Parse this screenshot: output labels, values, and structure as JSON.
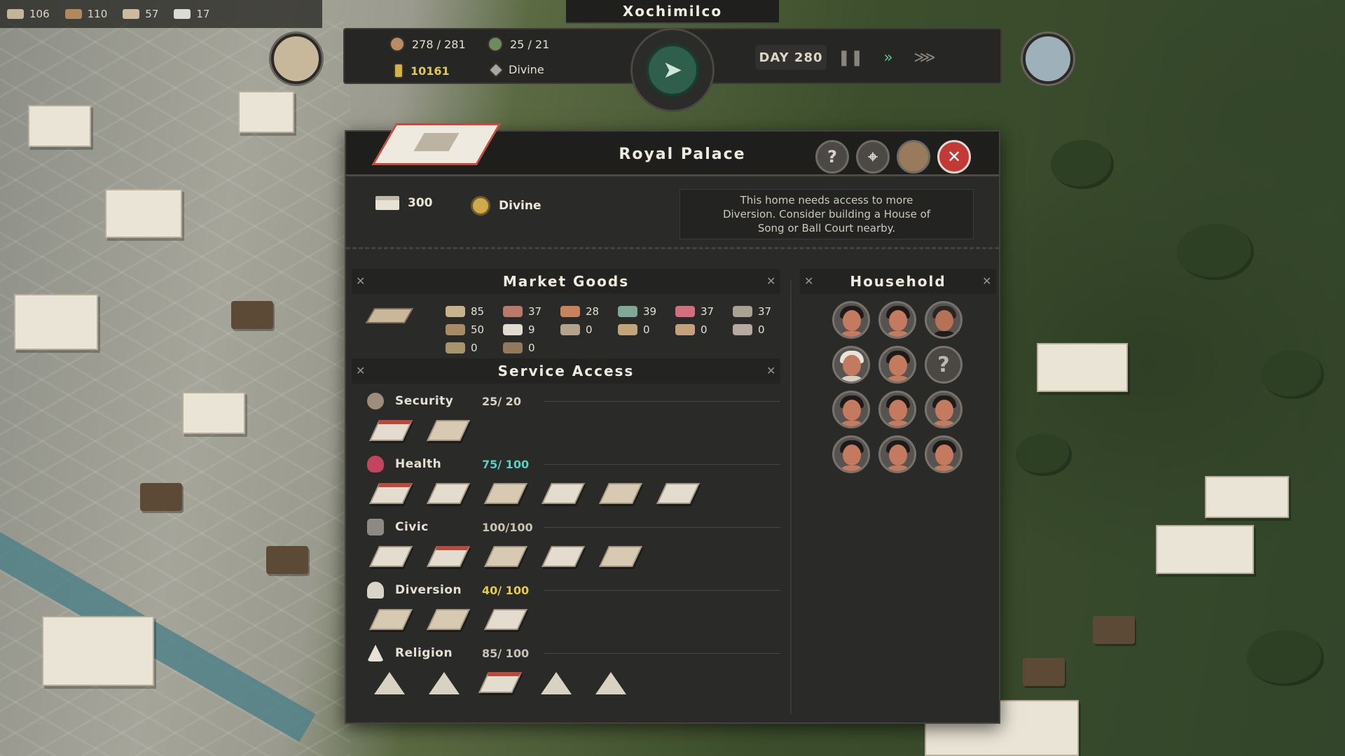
{
  "top_resources": [
    {
      "icon": "people-icon",
      "value": "106"
    },
    {
      "icon": "crate-icon",
      "value": "110"
    },
    {
      "icon": "maize-icon",
      "value": "57"
    },
    {
      "icon": "stone-icon",
      "value": "17"
    }
  ],
  "city": {
    "name": "Xochimilco"
  },
  "hud": {
    "population": "278 / 281",
    "workers": "25 / 21",
    "treasury": "10161",
    "rank": "Divine",
    "day": "DAY 280"
  },
  "panel": {
    "title": "Royal Palace",
    "housing_capacity": "300",
    "tier": "Divine",
    "notice": "This home needs access to more\nDiversion.  Consider building a House of\nSong or Ball Court nearby.",
    "buttons": {
      "help": "?",
      "close": "✕"
    },
    "market_title": "Market Goods",
    "service_title": "Service Access",
    "household_title": "Household",
    "goods": [
      {
        "icon": "maize-icon",
        "value": "85"
      },
      {
        "icon": "beans-icon",
        "value": "37"
      },
      {
        "icon": "fruit-icon",
        "value": "28"
      },
      {
        "icon": "greens-icon",
        "value": "39"
      },
      {
        "icon": "fish-icon",
        "value": "37"
      },
      {
        "icon": "cacao-icon",
        "value": "37"
      },
      {
        "icon": "wood-icon",
        "value": "50"
      },
      {
        "icon": "cotton-icon",
        "value": "9"
      },
      {
        "icon": "pottery-icon",
        "value": "0"
      },
      {
        "icon": "tools-icon",
        "value": "0"
      },
      {
        "icon": "cloth-icon",
        "value": "0"
      },
      {
        "icon": "feather-icon",
        "value": "0"
      },
      {
        "icon": "jade-icon",
        "value": "0"
      },
      {
        "icon": "obsidian-icon",
        "value": "0"
      }
    ],
    "services": [
      {
        "name": "Security",
        "value": "25/ 20",
        "color": "#d8d1c2",
        "icon_color": "#9e8d7a",
        "buildings": 2
      },
      {
        "name": "Health",
        "value": "75/ 100",
        "color": "#56d1c3",
        "icon_color": "#c2445e",
        "buildings": 6
      },
      {
        "name": "Civic",
        "value": "100/100",
        "color": "#c9c3b6",
        "icon_color": "#8d8a84",
        "buildings": 5
      },
      {
        "name": "Diversion",
        "value": "40/ 100",
        "color": "#e7c94d",
        "icon_color": "#d9d4c9",
        "buildings": 3
      },
      {
        "name": "Religion",
        "value": "85/ 100",
        "color": "#c9c3b6",
        "icon_color": "#e8e2d6",
        "buildings": 5
      }
    ],
    "household": [
      {
        "type": "adult"
      },
      {
        "type": "adult"
      },
      {
        "type": "elder"
      },
      {
        "type": "adult"
      },
      {
        "type": "adult"
      },
      {
        "type": "unknown",
        "label": "?"
      },
      {
        "type": "adult"
      },
      {
        "type": "adult"
      },
      {
        "type": "adult"
      },
      {
        "type": "adult"
      },
      {
        "type": "adult"
      },
      {
        "type": "adult"
      }
    ]
  }
}
